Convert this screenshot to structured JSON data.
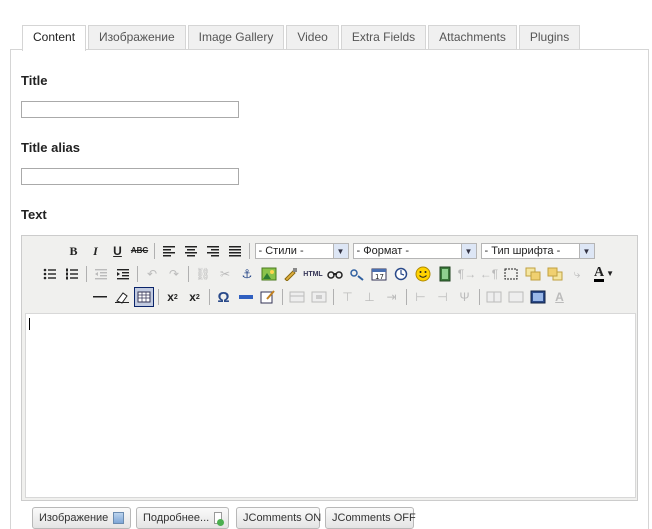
{
  "tabs": [
    "Content",
    "Изображение",
    "Image Gallery",
    "Video",
    "Extra Fields",
    "Attachments",
    "Plugins"
  ],
  "fields": {
    "title_label": "Title",
    "title_value": "",
    "alias_label": "Title alias",
    "alias_value": "",
    "text_label": "Text"
  },
  "editor": {
    "toolbar1": {
      "bold": "B",
      "italic": "I",
      "underline": "U",
      "strike": "ABC",
      "styles_select": "- Стили -",
      "format_select": "- Формат -",
      "font_select": "- Тип шрифта -"
    },
    "toolbar2": {
      "html": "HTML"
    },
    "toolbar3": {
      "omega": "Ω"
    }
  },
  "buttons": {
    "image": "Изображение",
    "readmore": "Подробнее...",
    "jcomments_on": "JComments ON",
    "jcomments_off": "JComments OFF"
  }
}
